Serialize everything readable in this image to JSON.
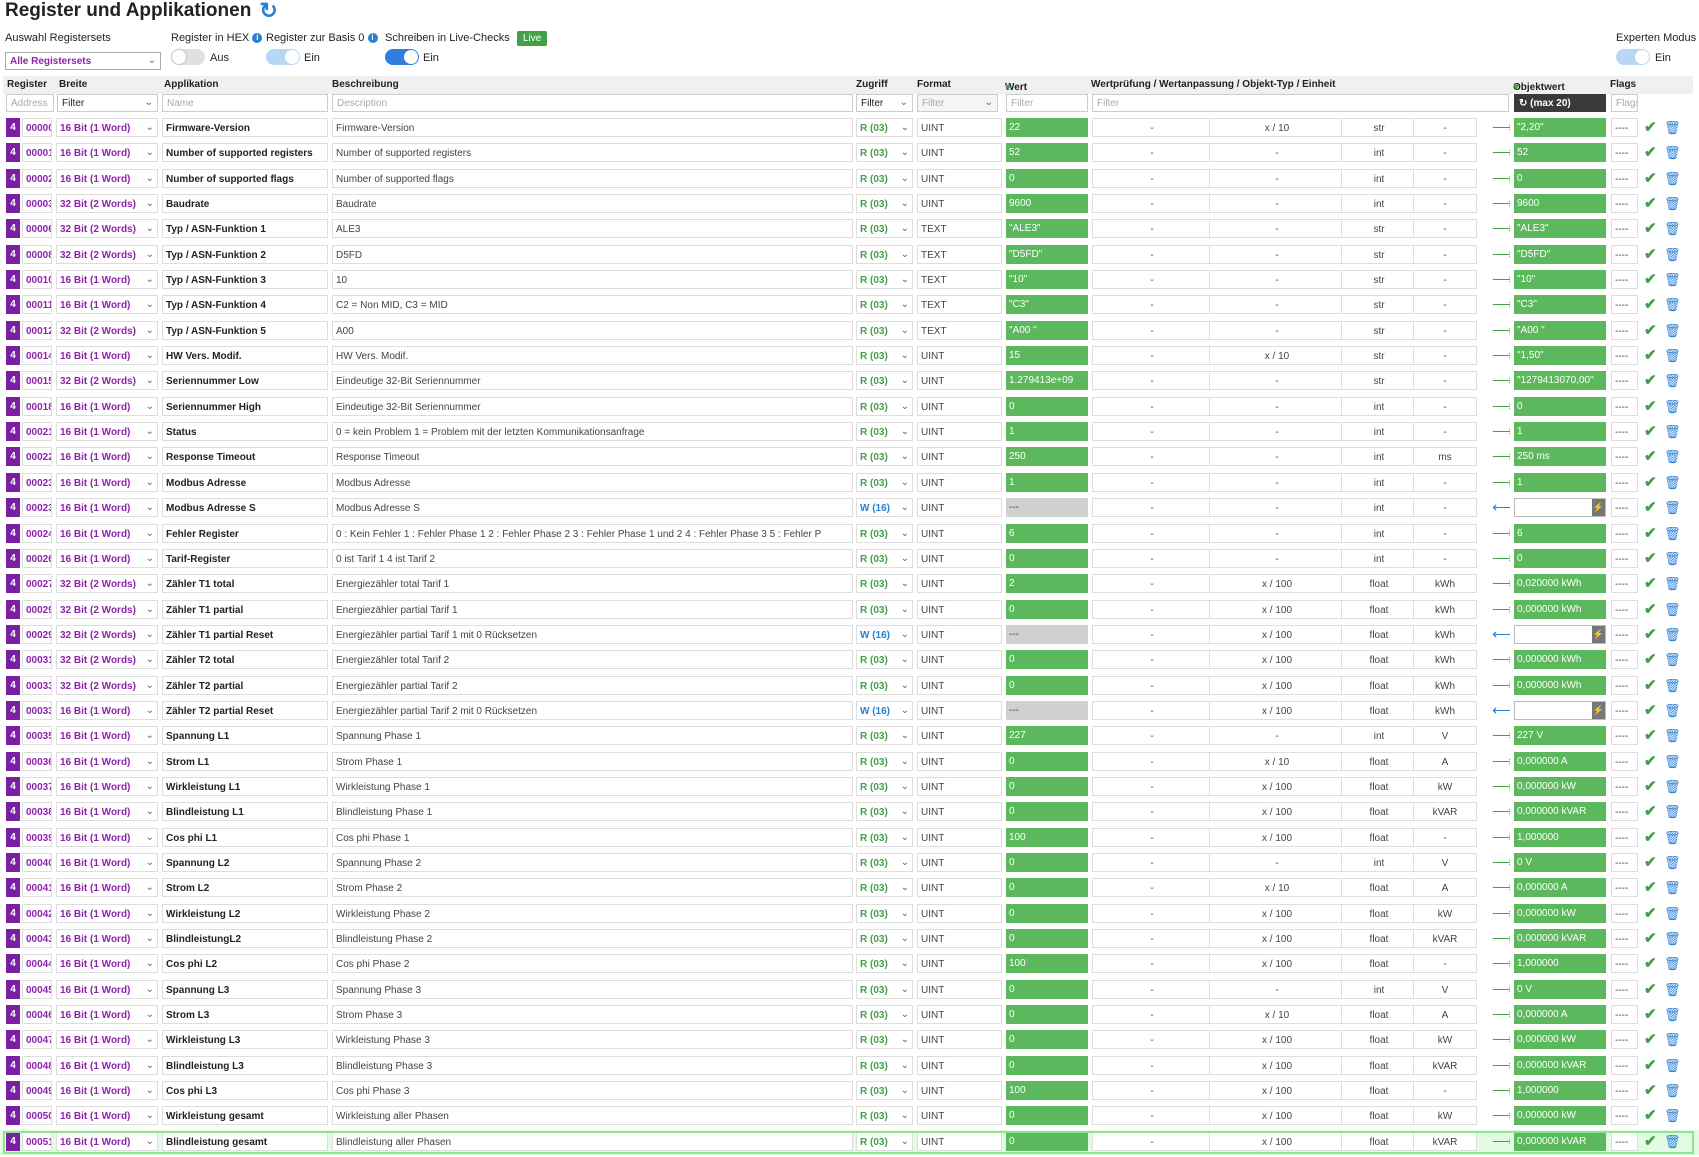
{
  "header": {
    "title": "Register und Applikationen",
    "auswahl_label": "Auswahl Registersets",
    "auswahl_value": "Alle Registersets",
    "hex_label": "Register in HEX",
    "hex_state": "Aus",
    "basis_label": "Register zur Basis 0",
    "basis_state": "Ein",
    "write_label": "Schreiben in Live-Checks",
    "live_badge": "Live",
    "write_state": "Ein",
    "expert_label": "Experten Modus",
    "expert_state": "Ein"
  },
  "columns": {
    "register": "Register",
    "breite": "Breite",
    "applikation": "Applikation",
    "beschreibung": "Beschreibung",
    "zugriff": "Zugriff",
    "format": "Format",
    "wert": "Wert",
    "wertpruefung": "Wertprüfung / Wertanpassung / Objekt-Typ / Einheit",
    "objektwert": "Objektwert",
    "flags": "Flags"
  },
  "filters": {
    "address": "Address",
    "breite": "Filter",
    "name": "Name",
    "description": "Description",
    "zugriff": "Filter",
    "format": "Filter",
    "wert": "Filter",
    "wertpruefung": "Filter",
    "objektwert": "(max 20)",
    "flags": "Flags"
  },
  "icons": {
    "refresh": "refresh-icon",
    "heart": "heart-icon",
    "arrow_right": "arrow-right-icon",
    "arrow_left": "arrow-left-icon",
    "check": "check-icon",
    "trash": "trash-icon",
    "bolt": "bolt-icon"
  },
  "colors": {
    "purple": "#7b1fa2",
    "green": "#5cb85c",
    "blue": "#2a7fd4"
  },
  "rows": [
    {
      "n": "4",
      "addr": "00000",
      "width": "16 Bit (1 Word)",
      "app": "Firmware-Version",
      "desc": "Firmware-Version",
      "acc": "R (03)",
      "fmt": "UINT",
      "val": "22",
      "c1": "-",
      "c2": "x / 10",
      "c3": "str",
      "c4": "-",
      "ov": "\"2,20\"",
      "fl": "----"
    },
    {
      "n": "4",
      "addr": "00001",
      "width": "16 Bit (1 Word)",
      "app": "Number of supported registers",
      "desc": "Number of supported registers",
      "acc": "R (03)",
      "fmt": "UINT",
      "val": "52",
      "c1": "-",
      "c2": "-",
      "c3": "int",
      "c4": "-",
      "ov": "52",
      "fl": "----"
    },
    {
      "n": "4",
      "addr": "00002",
      "width": "16 Bit (1 Word)",
      "app": "Number of supported flags",
      "desc": "Number of supported flags",
      "acc": "R (03)",
      "fmt": "UINT",
      "val": "0",
      "c1": "-",
      "c2": "-",
      "c3": "int",
      "c4": "-",
      "ov": "0",
      "fl": "----"
    },
    {
      "n": "4",
      "addr": "00003",
      "width": "32 Bit (2 Words)",
      "app": "Baudrate",
      "desc": "Baudrate",
      "acc": "R (03)",
      "fmt": "UINT",
      "val": "9600",
      "c1": "-",
      "c2": "-",
      "c3": "int",
      "c4": "-",
      "ov": "9600",
      "fl": "----"
    },
    {
      "n": "4",
      "addr": "00006",
      "width": "32 Bit (2 Words)",
      "app": "Typ / ASN-Funktion 1",
      "desc": "ALE3",
      "acc": "R (03)",
      "fmt": "TEXT",
      "val": "\"ALE3\"",
      "c1": "-",
      "c2": "-",
      "c3": "str",
      "c4": "-",
      "ov": "\"ALE3\"",
      "fl": "----"
    },
    {
      "n": "4",
      "addr": "00008",
      "width": "32 Bit (2 Words)",
      "app": "Typ / ASN-Funktion 2",
      "desc": "D5FD",
      "acc": "R (03)",
      "fmt": "TEXT",
      "val": "\"D5FD\"",
      "c1": "-",
      "c2": "-",
      "c3": "str",
      "c4": "-",
      "ov": "\"D5FD\"",
      "fl": "----"
    },
    {
      "n": "4",
      "addr": "00010",
      "width": "16 Bit (1 Word)",
      "app": "Typ / ASN-Funktion 3",
      "desc": "10",
      "acc": "R (03)",
      "fmt": "TEXT",
      "val": "\"10\"",
      "c1": "-",
      "c2": "-",
      "c3": "str",
      "c4": "-",
      "ov": "\"10\"",
      "fl": "----"
    },
    {
      "n": "4",
      "addr": "00011",
      "width": "16 Bit (1 Word)",
      "app": "Typ / ASN-Funktion 4",
      "desc": "C2 = Non MID,  C3 = MID",
      "acc": "R (03)",
      "fmt": "TEXT",
      "val": "\"C3\"",
      "c1": "-",
      "c2": "-",
      "c3": "str",
      "c4": "-",
      "ov": "\"C3\"",
      "fl": "----"
    },
    {
      "n": "4",
      "addr": "00012",
      "width": "32 Bit (2 Words)",
      "app": "Typ / ASN-Funktion 5",
      "desc": "A00",
      "acc": "R (03)",
      "fmt": "TEXT",
      "val": "\"A00 \"",
      "c1": "-",
      "c2": "-",
      "c3": "str",
      "c4": "-",
      "ov": "\"A00 \"",
      "fl": "----"
    },
    {
      "n": "4",
      "addr": "00014",
      "width": "16 Bit (1 Word)",
      "app": "HW Vers. Modif.",
      "desc": "HW Vers. Modif.",
      "acc": "R (03)",
      "fmt": "UINT",
      "val": "15",
      "c1": "-",
      "c2": "x / 10",
      "c3": "str",
      "c4": "-",
      "ov": "\"1,50\"",
      "fl": "----"
    },
    {
      "n": "4",
      "addr": "00015",
      "width": "32 Bit (2 Words)",
      "app": "Seriennummer Low",
      "desc": "Eindeutige 32-Bit Seriennummer",
      "acc": "R (03)",
      "fmt": "UINT",
      "val": "1.279413e+09",
      "c1": "-",
      "c2": "-",
      "c3": "str",
      "c4": "-",
      "ov": "\"1279413070,00\"",
      "fl": "----"
    },
    {
      "n": "4",
      "addr": "00018",
      "width": "16 Bit (1 Word)",
      "app": "Seriennummer High",
      "desc": "Eindeutige 32-Bit Seriennummer",
      "acc": "R (03)",
      "fmt": "UINT",
      "val": "0",
      "c1": "-",
      "c2": "-",
      "c3": "int",
      "c4": "-",
      "ov": "0",
      "fl": "----"
    },
    {
      "n": "4",
      "addr": "00021",
      "width": "16 Bit (1 Word)",
      "app": "Status",
      "desc": "0 = kein Problem 1 = Problem mit der letzten Kommunikationsanfrage",
      "acc": "R (03)",
      "fmt": "UINT",
      "val": "1",
      "c1": "-",
      "c2": "-",
      "c3": "int",
      "c4": "-",
      "ov": "1",
      "fl": "----"
    },
    {
      "n": "4",
      "addr": "00022",
      "width": "16 Bit (1 Word)",
      "app": "Response Timeout",
      "desc": "Response Timeout",
      "acc": "R (03)",
      "fmt": "UINT",
      "val": "250",
      "c1": "-",
      "c2": "-",
      "c3": "int",
      "c4": "ms",
      "ov": "250 ms",
      "fl": "----"
    },
    {
      "n": "4",
      "addr": "00023",
      "width": "16 Bit (1 Word)",
      "app": "Modbus Adresse",
      "desc": "Modbus Adresse",
      "acc": "R (03)",
      "fmt": "UINT",
      "val": "1",
      "c1": "-",
      "c2": "-",
      "c3": "int",
      "c4": "-",
      "ov": "1",
      "fl": "----"
    },
    {
      "n": "4",
      "addr": "00023",
      "width": "16 Bit (1 Word)",
      "app": "Modbus Adresse S",
      "desc": "Modbus Adresse S",
      "acc": "W (16)",
      "fmt": "UINT",
      "val": "---",
      "c1": "-",
      "c2": "-",
      "c3": "int",
      "c4": "-",
      "ov": "",
      "fl": "----",
      "write": true
    },
    {
      "n": "4",
      "addr": "00024",
      "width": "16 Bit (1 Word)",
      "app": "Fehler Register",
      "desc": "0 : Kein Fehler 1 : Fehler Phase 1 2 : Fehler Phase 2 3 : Fehler Phase 1 und 2 4 : Fehler Phase 3 5 : Fehler P",
      "acc": "R (03)",
      "fmt": "UINT",
      "val": "6",
      "c1": "-",
      "c2": "-",
      "c3": "int",
      "c4": "-",
      "ov": "6",
      "fl": "----"
    },
    {
      "n": "4",
      "addr": "00026",
      "width": "16 Bit (1 Word)",
      "app": "Tarif-Register",
      "desc": "0 ist Tarif 1 4 ist Tarif 2",
      "acc": "R (03)",
      "fmt": "UINT",
      "val": "0",
      "c1": "-",
      "c2": "-",
      "c3": "int",
      "c4": "-",
      "ov": "0",
      "fl": "----"
    },
    {
      "n": "4",
      "addr": "00027",
      "width": "32 Bit (2 Words)",
      "app": "Zähler T1 total",
      "desc": "Energiezähler total Tarif 1",
      "acc": "R (03)",
      "fmt": "UINT",
      "val": "2",
      "c1": "-",
      "c2": "x / 100",
      "c3": "float",
      "c4": "kWh",
      "ov": "0,020000 kWh",
      "fl": "----"
    },
    {
      "n": "4",
      "addr": "00029",
      "width": "32 Bit (2 Words)",
      "app": "Zähler T1 partial",
      "desc": "Energiezähler partial Tarif 1",
      "acc": "R (03)",
      "fmt": "UINT",
      "val": "0",
      "c1": "-",
      "c2": "x / 100",
      "c3": "float",
      "c4": "kWh",
      "ov": "0,000000 kWh",
      "fl": "----"
    },
    {
      "n": "4",
      "addr": "00029",
      "width": "32 Bit (2 Words)",
      "app": "Zähler T1 partial Reset",
      "desc": "Energiezähler partial Tarif 1 mit 0 Rücksetzen",
      "acc": "W (16)",
      "fmt": "UINT",
      "val": "---",
      "c1": "-",
      "c2": "x / 100",
      "c3": "float",
      "c4": "kWh",
      "ov": "",
      "fl": "----",
      "write": true
    },
    {
      "n": "4",
      "addr": "00031",
      "width": "32 Bit (2 Words)",
      "app": "Zähler T2 total",
      "desc": "Energiezähler total Tarif 2",
      "acc": "R (03)",
      "fmt": "UINT",
      "val": "0",
      "c1": "-",
      "c2": "x / 100",
      "c3": "float",
      "c4": "kWh",
      "ov": "0,000000 kWh",
      "fl": "----"
    },
    {
      "n": "4",
      "addr": "00033",
      "width": "32 Bit (2 Words)",
      "app": "Zähler T2 partial",
      "desc": "Energiezähler partial Tarif 2",
      "acc": "R (03)",
      "fmt": "UINT",
      "val": "0",
      "c1": "-",
      "c2": "x / 100",
      "c3": "float",
      "c4": "kWh",
      "ov": "0,000000 kWh",
      "fl": "----"
    },
    {
      "n": "4",
      "addr": "00033",
      "width": "16 Bit (1 Word)",
      "app": "Zähler T2 partial Reset",
      "desc": "Energiezähler partial Tarif 2 mit 0 Rücksetzen",
      "acc": "W (16)",
      "fmt": "UINT",
      "val": "---",
      "c1": "-",
      "c2": "x / 100",
      "c3": "float",
      "c4": "kWh",
      "ov": "",
      "fl": "----",
      "write": true
    },
    {
      "n": "4",
      "addr": "00035",
      "width": "16 Bit (1 Word)",
      "app": "Spannung L1",
      "desc": "Spannung Phase 1",
      "acc": "R (03)",
      "fmt": "UINT",
      "val": "227",
      "c1": "-",
      "c2": "-",
      "c3": "int",
      "c4": "V",
      "ov": "227 V",
      "fl": "----"
    },
    {
      "n": "4",
      "addr": "00036",
      "width": "16 Bit (1 Word)",
      "app": "Strom L1",
      "desc": "Strom Phase 1",
      "acc": "R (03)",
      "fmt": "UINT",
      "val": "0",
      "c1": "-",
      "c2": "x / 10",
      "c3": "float",
      "c4": "A",
      "ov": "0,000000 A",
      "fl": "----"
    },
    {
      "n": "4",
      "addr": "00037",
      "width": "16 Bit (1 Word)",
      "app": "Wirkleistung L1",
      "desc": "Wirkleistung Phase 1",
      "acc": "R (03)",
      "fmt": "UINT",
      "val": "0",
      "c1": "-",
      "c2": "x / 100",
      "c3": "float",
      "c4": "kW",
      "ov": "0,000000 kW",
      "fl": "----"
    },
    {
      "n": "4",
      "addr": "00038",
      "width": "16 Bit (1 Word)",
      "app": "Blindleistung L1",
      "desc": "Blindleistung Phase 1",
      "acc": "R (03)",
      "fmt": "UINT",
      "val": "0",
      "c1": "-",
      "c2": "x / 100",
      "c3": "float",
      "c4": "kVAR",
      "ov": "0,000000 kVAR",
      "fl": "----"
    },
    {
      "n": "4",
      "addr": "00039",
      "width": "16 Bit (1 Word)",
      "app": "Cos phi L1",
      "desc": "Cos phi Phase 1",
      "acc": "R (03)",
      "fmt": "UINT",
      "val": "100",
      "c1": "-",
      "c2": "x / 100",
      "c3": "float",
      "c4": "-",
      "ov": "1,000000",
      "fl": "----"
    },
    {
      "n": "4",
      "addr": "00040",
      "width": "16 Bit (1 Word)",
      "app": "Spannung L2",
      "desc": "Spannung Phase 2",
      "acc": "R (03)",
      "fmt": "UINT",
      "val": "0",
      "c1": "-",
      "c2": "-",
      "c3": "int",
      "c4": "V",
      "ov": "0 V",
      "fl": "----"
    },
    {
      "n": "4",
      "addr": "00041",
      "width": "16 Bit (1 Word)",
      "app": "Strom L2",
      "desc": "Strom Phase 2",
      "acc": "R (03)",
      "fmt": "UINT",
      "val": "0",
      "c1": "-",
      "c2": "x / 10",
      "c3": "float",
      "c4": "A",
      "ov": "0,000000 A",
      "fl": "----"
    },
    {
      "n": "4",
      "addr": "00042",
      "width": "16 Bit (1 Word)",
      "app": "Wirkleistung L2",
      "desc": "Wirkleistung Phase 2",
      "acc": "R (03)",
      "fmt": "UINT",
      "val": "0",
      "c1": "-",
      "c2": "x / 100",
      "c3": "float",
      "c4": "kW",
      "ov": "0,000000 kW",
      "fl": "----"
    },
    {
      "n": "4",
      "addr": "00043",
      "width": "16 Bit (1 Word)",
      "app": "BlindleistungL2",
      "desc": "Blindleistung Phase 2",
      "acc": "R (03)",
      "fmt": "UINT",
      "val": "0",
      "c1": "-",
      "c2": "x / 100",
      "c3": "float",
      "c4": "kVAR",
      "ov": "0,000000 kVAR",
      "fl": "----"
    },
    {
      "n": "4",
      "addr": "00044",
      "width": "16 Bit (1 Word)",
      "app": "Cos phi L2",
      "desc": "Cos phi Phase 2",
      "acc": "R (03)",
      "fmt": "UINT",
      "val": "100",
      "c1": "-",
      "c2": "x / 100",
      "c3": "float",
      "c4": "-",
      "ov": "1,000000",
      "fl": "----"
    },
    {
      "n": "4",
      "addr": "00045",
      "width": "16 Bit (1 Word)",
      "app": "Spannung L3",
      "desc": "Spannung Phase 3",
      "acc": "R (03)",
      "fmt": "UINT",
      "val": "0",
      "c1": "-",
      "c2": "-",
      "c3": "int",
      "c4": "V",
      "ov": "0 V",
      "fl": "----"
    },
    {
      "n": "4",
      "addr": "00046",
      "width": "16 Bit (1 Word)",
      "app": "Strom L3",
      "desc": "Strom Phase 3",
      "acc": "R (03)",
      "fmt": "UINT",
      "val": "0",
      "c1": "-",
      "c2": "x / 10",
      "c3": "float",
      "c4": "A",
      "ov": "0,000000 A",
      "fl": "----"
    },
    {
      "n": "4",
      "addr": "00047",
      "width": "16 Bit (1 Word)",
      "app": "Wirkleistung L3",
      "desc": "Wirkleistung Phase 3",
      "acc": "R (03)",
      "fmt": "UINT",
      "val": "0",
      "c1": "-",
      "c2": "x / 100",
      "c3": "float",
      "c4": "kW",
      "ov": "0,000000 kW",
      "fl": "----"
    },
    {
      "n": "4",
      "addr": "00048",
      "width": "16 Bit (1 Word)",
      "app": "Blindleistung L3",
      "desc": "Blindleistung Phase 3",
      "acc": "R (03)",
      "fmt": "UINT",
      "val": "0",
      "c1": "-",
      "c2": "x / 100",
      "c3": "float",
      "c4": "kVAR",
      "ov": "0,000000 kVAR",
      "fl": "----"
    },
    {
      "n": "4",
      "addr": "00049",
      "width": "16 Bit (1 Word)",
      "app": "Cos phi L3",
      "desc": "Cos phi Phase 3",
      "acc": "R (03)",
      "fmt": "UINT",
      "val": "100",
      "c1": "-",
      "c2": "x / 100",
      "c3": "float",
      "c4": "-",
      "ov": "1,000000",
      "fl": "----"
    },
    {
      "n": "4",
      "addr": "00050",
      "width": "16 Bit (1 Word)",
      "app": "Wirkleistung gesamt",
      "desc": "Wirkleistung aller Phasen",
      "acc": "R (03)",
      "fmt": "UINT",
      "val": "0",
      "c1": "-",
      "c2": "x / 100",
      "c3": "float",
      "c4": "kW",
      "ov": "0,000000 kW",
      "fl": "----"
    },
    {
      "n": "4",
      "addr": "00051",
      "width": "16 Bit (1 Word)",
      "app": "Blindleistung gesamt",
      "desc": "Blindleistung aller Phasen",
      "acc": "R (03)",
      "fmt": "UINT",
      "val": "0",
      "c1": "-",
      "c2": "x / 100",
      "c3": "float",
      "c4": "kVAR",
      "ov": "0,000000 kVAR",
      "fl": "----"
    }
  ]
}
